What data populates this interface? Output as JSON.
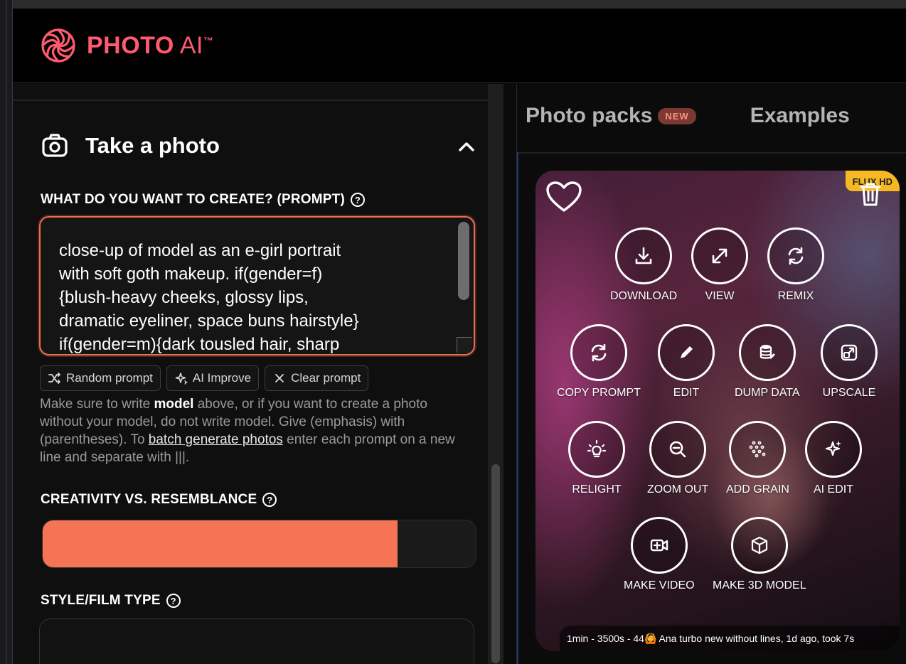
{
  "app": {
    "name_main": "PHOTO",
    "name_ai": " AI",
    "name_tm": "™",
    "brand_color": "#ff5a6e"
  },
  "left": {
    "section_title": "Take a photo",
    "prompt_label": "WHAT DO YOU WANT TO CREATE? (PROMPT)",
    "prompt_value": "close-up of model as an e-girl portrait\nwith soft goth makeup. if(gender=f)\n{blush-heavy cheeks, glossy lips,\ndramatic eyeliner, space buns hairstyle}\nif(gender=m){dark tousled hair, sharp",
    "chips": [
      {
        "label": "Random prompt",
        "icon": "shuffle-icon"
      },
      {
        "label": "AI Improve",
        "icon": "sparkle-icon"
      },
      {
        "label": "Clear prompt",
        "icon": "close-icon"
      }
    ],
    "help": {
      "t1": "Make sure to write ",
      "bold": "model",
      "t2": " above, or if you want to create a photo without your model, do not write model. Give (emphasis) with (parentheses). To ",
      "link": "batch generate photos",
      "t3": " enter each prompt on a new line and separate with |||."
    },
    "creativity_label": "CREATIVITY VS. RESEMBLANCE",
    "creativity_value": 0.82,
    "style_label": "STYLE/FILM TYPE",
    "accent_color": "#f47454"
  },
  "right": {
    "tabs": [
      {
        "label": "Photo packs",
        "badge": "NEW"
      },
      {
        "label": "Examples"
      }
    ],
    "card": {
      "badge": "FLUX HD",
      "actions": [
        {
          "label": "DOWNLOAD",
          "icon": "download-icon"
        },
        {
          "label": "VIEW",
          "icon": "expand-icon"
        },
        {
          "label": "REMIX",
          "icon": "refresh-icon"
        },
        {
          "label": "COPY PROMPT",
          "icon": "refresh-icon"
        },
        {
          "label": "EDIT",
          "icon": "pencil-icon"
        },
        {
          "label": "DUMP DATA",
          "icon": "database-icon"
        },
        {
          "label": "UPSCALE",
          "icon": "upscale-icon"
        },
        {
          "label": "RELIGHT",
          "icon": "lightbulb-icon"
        },
        {
          "label": "ZOOM OUT",
          "icon": "zoom-out-icon"
        },
        {
          "label": "ADD GRAIN",
          "icon": "grain-icon"
        },
        {
          "label": "AI EDIT",
          "icon": "sparkle-icon"
        },
        {
          "label": "MAKE VIDEO",
          "icon": "video-icon"
        },
        {
          "label": "MAKE 3D MODEL",
          "icon": "cube-icon"
        }
      ],
      "footer": "1min - 3500s - 44🙆 Ana turbo new without lines, 1d ago, took 7s"
    }
  }
}
